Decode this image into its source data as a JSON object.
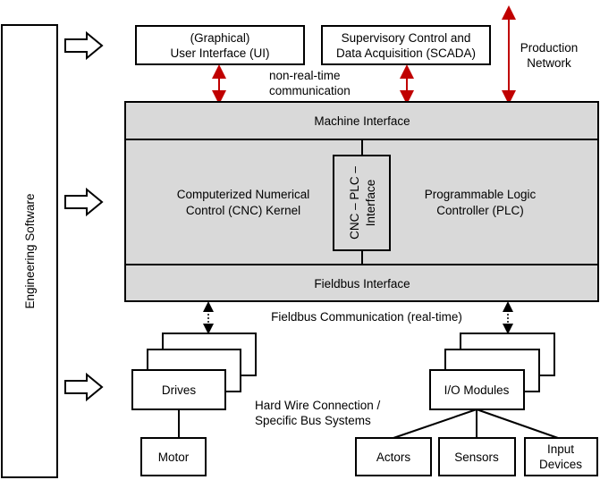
{
  "engineering_software": "Engineering Software",
  "ui_box": {
    "line1": "(Graphical)",
    "line2": "User Interface (UI)"
  },
  "scada_box": {
    "line1": "Supervisory Control and",
    "line2": "Data Acquisition (SCADA)"
  },
  "production_network": {
    "line1": "Production",
    "line2": "Network"
  },
  "non_real_time": {
    "line1": "non-real-time",
    "line2": "communication"
  },
  "machine_interface": "Machine Interface",
  "cnc_kernel": {
    "line1": "Computerized Numerical",
    "line2": "Control (CNC) Kernel"
  },
  "cnc_plc_interface": {
    "line1": "CNC – PLC –",
    "line2": "Interface"
  },
  "plc": {
    "line1": "Programmable Logic",
    "line2": "Controller (PLC)"
  },
  "fieldbus_interface": "Fieldbus Interface",
  "fieldbus_communication": "Fieldbus Communication (real-time)",
  "drives": "Drives",
  "io_modules": "I/O Modules",
  "hard_wire": {
    "line1": "Hard Wire Connection /",
    "line2": "Specific Bus Systems"
  },
  "motor": "Motor",
  "actors": "Actors",
  "sensors": "Sensors",
  "input_devices": {
    "line1": "Input",
    "line2": "Devices"
  },
  "colors": {
    "network_arrow": "#c00000",
    "core_fill": "#d9d9d9"
  }
}
